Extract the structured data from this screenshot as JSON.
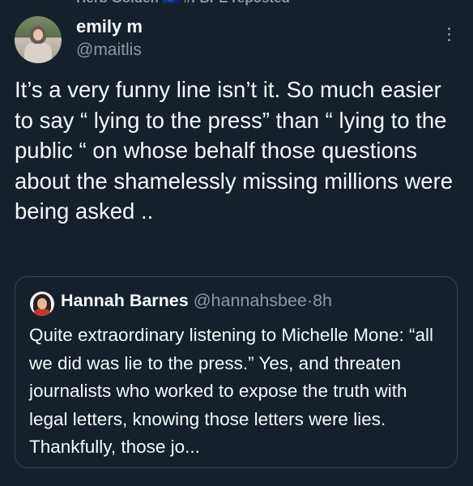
{
  "header": {
    "repost_text": "Herb Golden 🇪🇺 #FBPE reposted"
  },
  "tweet": {
    "display_name": "emily m",
    "handle": "@maitlis",
    "text": "It’s a very funny line isn’t it. So much easier to say “ lying to the press” than “ lying to the public “ on whose behalf those questions about the shamelessly missing millions were being asked .."
  },
  "quote": {
    "display_name": "Hannah Barnes",
    "handle": "@hannahsbee",
    "separator": "·",
    "time": "8h",
    "text": "Quite extraordinary listening to Michelle Mone: “all we did was lie to the press.” Yes, and threaten journalists who worked to expose the truth with legal letters, knowing those letters were lies. Thankfully, those jo..."
  },
  "icons": {
    "more": "more-vertical-icon"
  },
  "colors": {
    "background": "#15202b",
    "primary_text": "#f7f9f9",
    "secondary_text": "#8b98a5",
    "border": "#38444d"
  }
}
